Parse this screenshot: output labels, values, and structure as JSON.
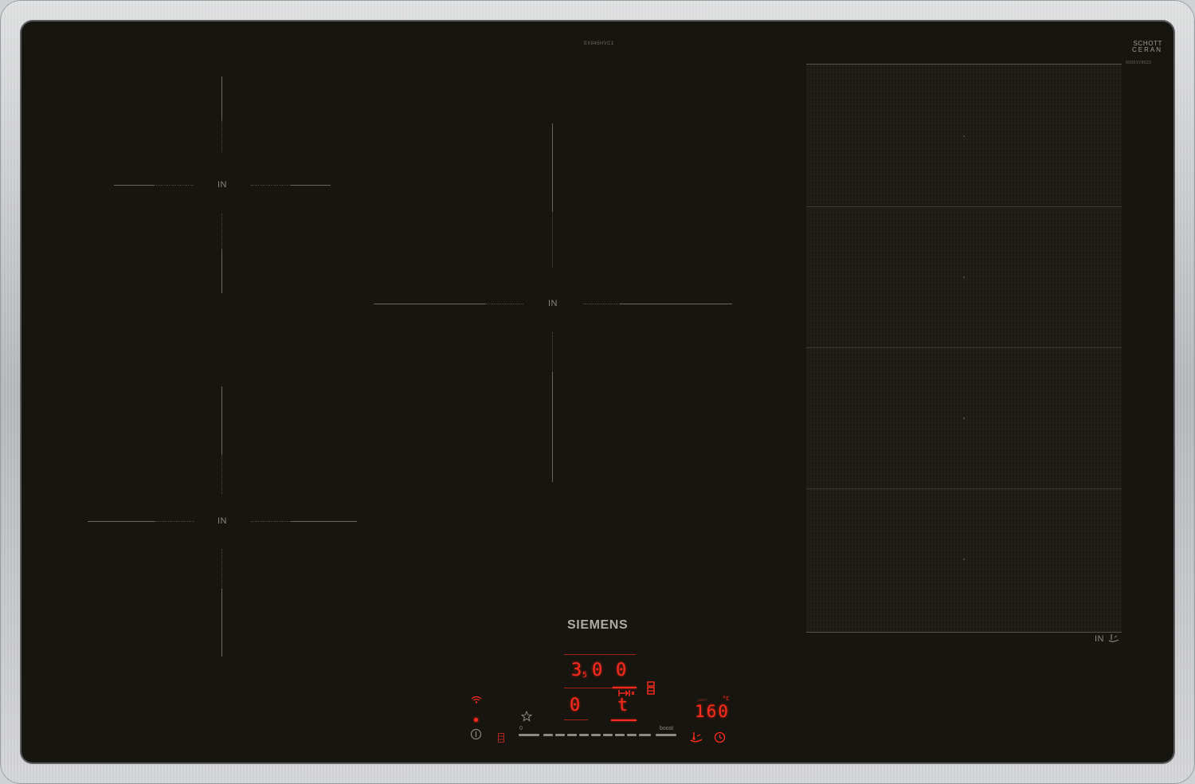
{
  "hob": {
    "brand": "SIEMENS",
    "model_code": "EX845HVC1",
    "glass_brand_line1": "SCHOTT",
    "glass_brand_line2": "CERAN",
    "glass_code": "00001V8623"
  },
  "zones": {
    "rear_left_label": "IN",
    "front_left_label": "IN",
    "center_label": "IN",
    "flex_label": "IN"
  },
  "display": {
    "timer_digits": [
      "3",
      "0",
      "0"
    ],
    "timer_subscript": "5",
    "level_digit": "0",
    "mode_char": "t",
    "temperature": "160",
    "temperature_unit": "°C",
    "temperature_caption": "pann",
    "slider_min_label": "0",
    "slider_max_label": "boost"
  },
  "colors": {
    "glass": "#17150f",
    "frame": "#c8cacc",
    "led_red": "#ff2a1e",
    "print_gray": "#8c8983"
  },
  "icons": {
    "wifi": "wifi-icon",
    "power": "power-icon",
    "favorite": "star-icon",
    "lock": "child-lock-icon",
    "transfer": "move-function-icon",
    "sensor": "frying-sensor-icon",
    "clock": "timer-icon"
  }
}
